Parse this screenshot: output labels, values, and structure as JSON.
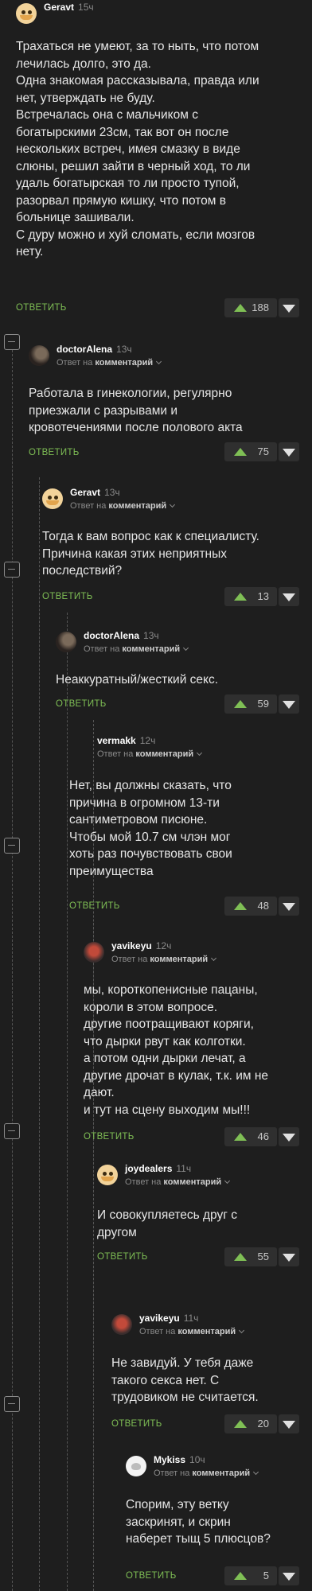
{
  "reply_prefix": "Ответ на",
  "reply_target": "комментарий",
  "reply_label": "ОТВЕТИТЬ",
  "comments": [
    {
      "author": "Geravt",
      "time": "15ч",
      "avatar": "cat-avatar",
      "lines": [
        "Трахаться не умеют, за то ныть, что потом",
        "лечилась долго, это да.",
        "Одна знакомая рассказывала, правда или",
        "нет, утверждать не буду.",
        "Встречалась она с мальчиком с",
        "богатырскими 23см, так вот он после",
        "нескольких встреч, имея смазку в виде",
        "слюны, решил  зайти в черный ход, то ли",
        "удаль богатырская то ли просто тупой,",
        "разорвал  прямую кишку, что потом в",
        "больнице зашивали.",
        "С дуру можно и хуй сломать, если мозгов",
        "нету."
      ],
      "rating": "188"
    },
    {
      "author": "doctorAlena",
      "time": "13ч",
      "avatar": "dark-avatar",
      "lines": [
        "Работала в гинекологии, регулярно",
        "приезжали с разрывами и",
        "кровотечениями после полового акта"
      ],
      "rating": "75"
    },
    {
      "author": "Geravt",
      "time": "13ч",
      "avatar": "cat-avatar",
      "lines": [
        "Тогда к вам вопрос как к специалисту.",
        "Причина какая этих неприятных",
        "последствий?"
      ],
      "rating": "13"
    },
    {
      "author": "doctorAlena",
      "time": "13ч",
      "avatar": "dark-avatar",
      "lines": [
        "Неаккуратный/жесткий секс."
      ],
      "rating": "59"
    },
    {
      "author": "vermakk",
      "time": "12ч",
      "avatar": "none",
      "lines": [
        "Нет, вы должны сказать, что",
        "причина в огромном 13-ти",
        "сантиметровом писюне.",
        "Чтобы мой 10.7 см члэн мог",
        "хоть раз почувствовать свои",
        "преимущества"
      ],
      "rating": "48"
    },
    {
      "author": "yavikeyu",
      "time": "12ч",
      "avatar": "red-avatar",
      "lines": [
        "мы, короткопенисные пацаны,",
        "короли в этом вопросе.",
        "другие поотращивают коряги,",
        "что дырки рвут как колготки.",
        "а потом одни дырки лечат, а",
        "другие дрочат в кулак, т.к. им не",
        "дают.",
        "и тут на сцену выходим мы!!!"
      ],
      "rating": "46"
    },
    {
      "author": "joydealers",
      "time": "11ч",
      "avatar": "cat-avatar",
      "lines": [
        "И совокупляетесь друг с",
        "другом"
      ],
      "rating": "55"
    },
    {
      "author": "yavikeyu",
      "time": "11ч",
      "avatar": "red-avatar",
      "lines": [
        "Не завидуй. У тебя даже",
        "такого секса нет. С",
        "трудовиком не считается."
      ],
      "rating": "20"
    },
    {
      "author": "Mykiss",
      "time": "10ч",
      "avatar": "white-avatar",
      "lines": [
        "Спорим, эту ветку",
        "заскринят, и скрин",
        "наберет тыщ 5 плюсцов?"
      ],
      "rating": "5"
    }
  ]
}
